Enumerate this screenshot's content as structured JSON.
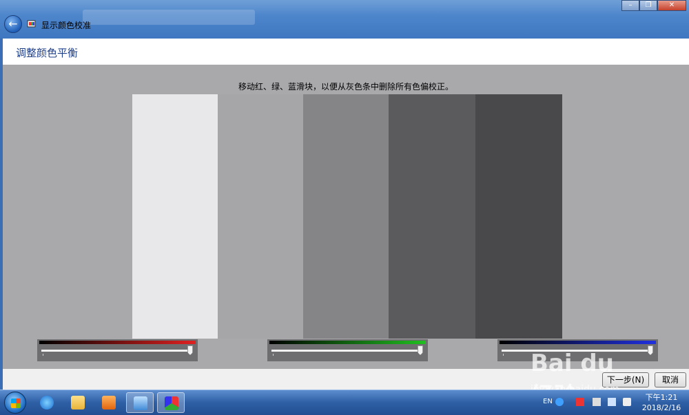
{
  "window": {
    "title": "显示颜色校准",
    "controls": {
      "minimize": "–",
      "maximize": "❐",
      "close": "✕"
    }
  },
  "header": {
    "page_title": "调整颜色平衡"
  },
  "content": {
    "instruction": "移动红、绿、蓝滑块，以便从灰色条中删除所有色偏校正。",
    "gray_bars": [
      {
        "color": "#e8e7ea"
      },
      {
        "color": "#a6a5a8"
      },
      {
        "color": "#858487"
      },
      {
        "color": "#5b5a5d"
      },
      {
        "color": "#49484b"
      }
    ],
    "sliders": [
      {
        "name": "red",
        "color": "#e02020",
        "value": 1.0
      },
      {
        "name": "green",
        "color": "#20c020",
        "value": 1.0
      },
      {
        "name": "blue",
        "color": "#2030e0",
        "value": 1.0
      }
    ]
  },
  "footer": {
    "next_label": "下一步(N)",
    "cancel_label": "取消"
  },
  "taskbar": {
    "language": "EN",
    "clock_time": "下午1:21",
    "clock_date": "2018/2/16"
  },
  "watermark": {
    "brand": "Bai du 经验",
    "url": "jingyan.baidu.com"
  }
}
